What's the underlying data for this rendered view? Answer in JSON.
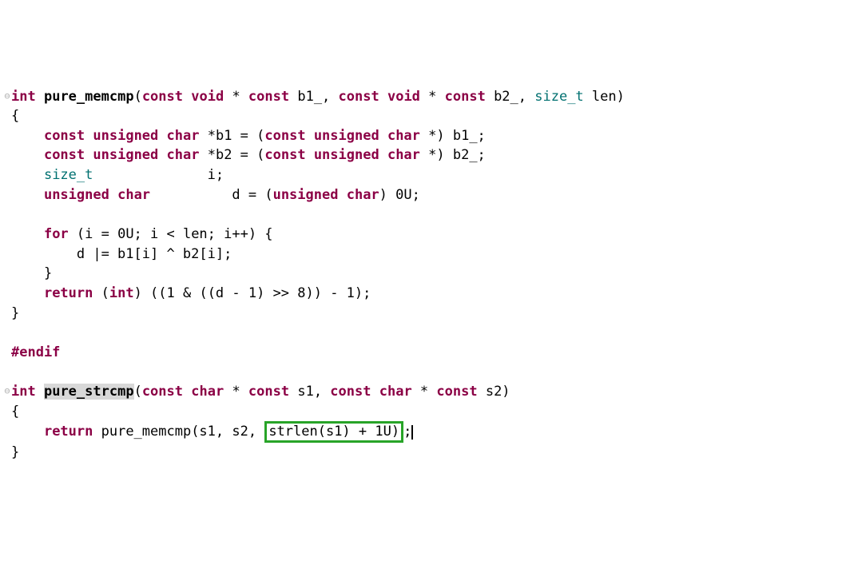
{
  "code": {
    "l1_fold": "⊖",
    "l1_int": "int",
    "l1_fn": "pure_memcmp",
    "l1_rest_a": "(",
    "l1_const1": "const",
    "l1_void1": "void",
    "l1_sp1": " * ",
    "l1_const2": "const",
    "l1_b1": " b1_, ",
    "l1_const3": "const",
    "l1_void2": "void",
    "l1_sp2": " * ",
    "l1_const4": "const",
    "l1_b2": " b2_, ",
    "l1_sizet": "size_t",
    "l1_len": " len)",
    "l2": "{",
    "l3_lead": "    ",
    "l3_const": "const",
    "l3_unsigned": "unsigned",
    "l3_char": "char",
    "l3_rest_a": " *b1 = (",
    "l3_const2": "const",
    "l3_unsigned2": "unsigned",
    "l3_char2": "char",
    "l3_rest_b": " *) b1_;",
    "l4_lead": "    ",
    "l4_const": "const",
    "l4_unsigned": "unsigned",
    "l4_char": "char",
    "l4_rest_a": " *b2 = (",
    "l4_const2": "const",
    "l4_unsigned2": "unsigned",
    "l4_char2": "char",
    "l4_rest_b": " *) b2_;",
    "l5_lead": "    ",
    "l5_sizet": "size_t",
    "l5_rest": "              i;",
    "l6_lead": "    ",
    "l6_unsigned": "unsigned",
    "l6_char": "char",
    "l6_rest_a": "          d = (",
    "l6_unsigned2": "unsigned",
    "l6_char2": "char",
    "l6_rest_b": ") 0U;",
    "l7": "",
    "l8_lead": "    ",
    "l8_for": "for",
    "l8_rest": " (i = 0U; i < len; i++) {",
    "l9": "        d |= b1[i] ^ b2[i];",
    "l10": "    }",
    "l11_lead": "    ",
    "l11_return": "return",
    "l11_rest_a": " (",
    "l11_int": "int",
    "l11_rest_b": ") ((1 & ((d - 1) >> 8)) - 1);",
    "l12": "}",
    "l13": "",
    "l14": "#endif",
    "l15": "",
    "l16_fold": "⊖",
    "l16_int": "int",
    "l16_fn": "pure_strcmp",
    "l16_rest_a": "(",
    "l16_const1": "const",
    "l16_char1": "char",
    "l16_sp1": " * ",
    "l16_const2": "const",
    "l16_s1": " s1, ",
    "l16_const3": "const",
    "l16_char2": "char",
    "l16_sp2": " * ",
    "l16_const4": "const",
    "l16_s2": " s2)",
    "l17": "{",
    "l18_lead": "    ",
    "l18_return": "return",
    "l18_rest_a": " pure_memcmp(s1, s2, ",
    "l18_box": "strlen(s1) + 1U)",
    "l18_rest_b": ";",
    "l19": "}"
  }
}
